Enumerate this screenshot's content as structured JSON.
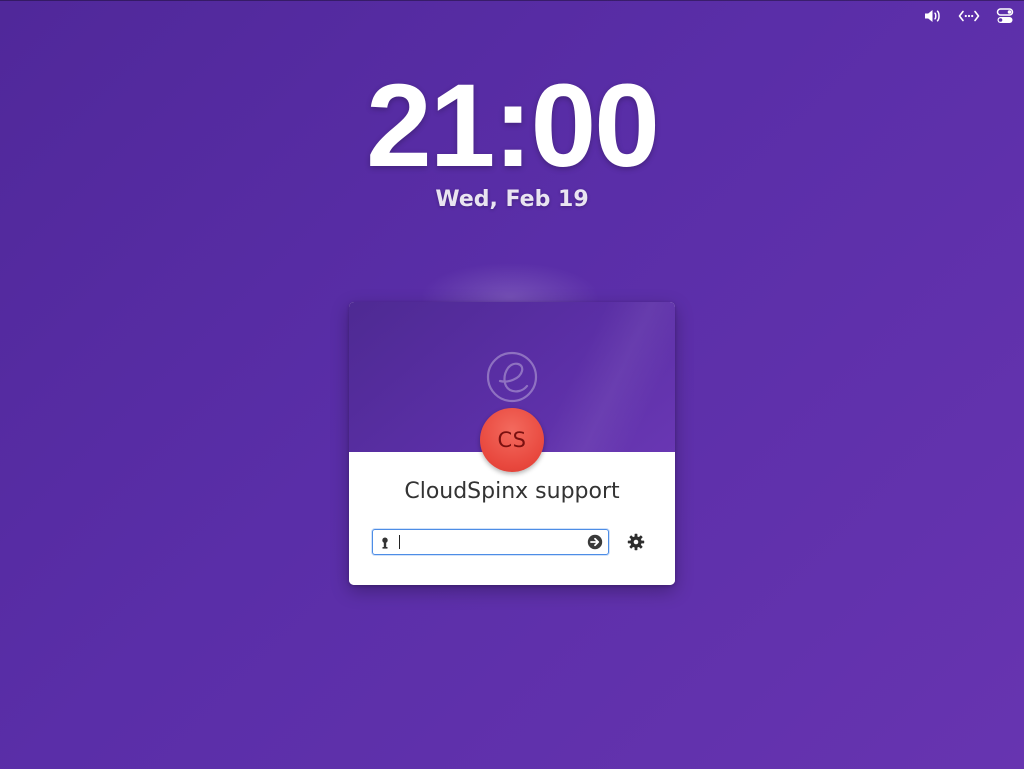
{
  "panel": {
    "indicators": [
      {
        "icon": "volume-icon"
      },
      {
        "icon": "network-icon"
      },
      {
        "icon": "session-toggle-icon"
      }
    ]
  },
  "lockscreen": {
    "time": "21:00",
    "date": "Wed, Feb 19"
  },
  "login_card": {
    "logo_icon": "elementary-logo-icon",
    "avatar_initials": "CS",
    "avatar_color": "#e8473d",
    "username": "CloudSpinx support",
    "password": {
      "value": "",
      "placeholder": ""
    },
    "field_focus_color": "#4d8de6"
  },
  "colors": {
    "background_start": "#50289a",
    "background_end": "#6734b0",
    "card_banner": "#5b2fa6",
    "card_body": "#ffffff"
  }
}
